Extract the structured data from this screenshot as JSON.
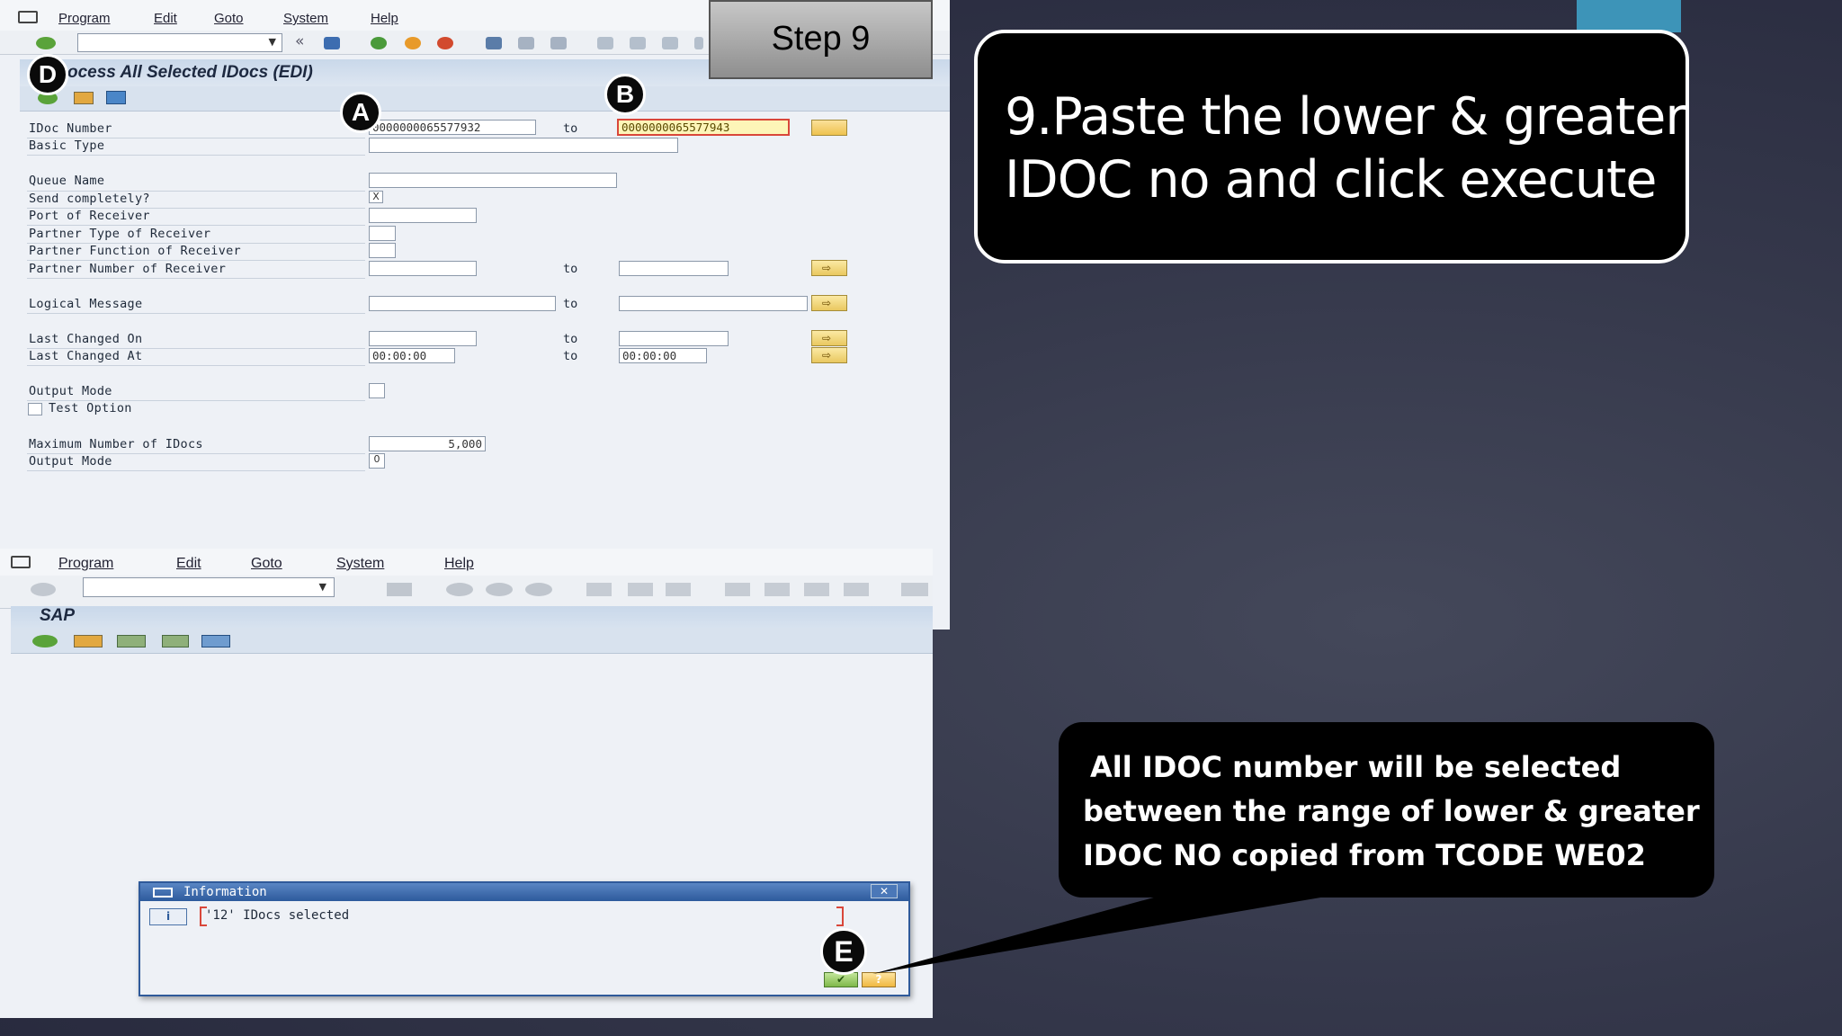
{
  "step": {
    "label": "Step 9"
  },
  "callouts": {
    "main_line1": "9.Paste the lower & greater",
    "main_line2": "IDOC no and click execute",
    "note_line1": "All IDOC number will be selected",
    "note_line2": "between the range of lower & greater",
    "note_line3": "IDOC NO copied from TCODE WE02"
  },
  "badges": {
    "a": "A",
    "b": "B",
    "d": "D",
    "e": "E"
  },
  "sap_top": {
    "menu": [
      "Program",
      "Edit",
      "Goto",
      "System",
      "Help"
    ],
    "title": "ocess All Selected IDocs (EDI)",
    "labels": {
      "idoc_number": "IDoc Number",
      "basic_type": "Basic Type",
      "queue_name": "Queue Name",
      "send_completely": "Send completely?",
      "port_of_receiver": "Port of Receiver",
      "partner_type": "Partner Type of Receiver",
      "partner_function": "Partner Function of Receiver",
      "partner_number": "Partner Number of Receiver",
      "logical_message": "Logical Message",
      "last_changed_on": "Last Changed On",
      "last_changed_at": "Last Changed At",
      "output_mode": "Output Mode",
      "test_option": "Test Option",
      "max_idocs": "Maximum Number of IDocs",
      "output_mode2": "Output Mode",
      "to": "to"
    },
    "values": {
      "idoc_from": "0000000065577932",
      "idoc_to": "0000000065577943",
      "send_completely": "X",
      "time_from": "00:00:00",
      "time_to": "00:00:00",
      "max_idocs": "5,000",
      "output_mode2": "0"
    }
  },
  "sap_bottom": {
    "menu": [
      "Program",
      "Edit",
      "Goto",
      "System",
      "Help"
    ],
    "title": "SAP"
  },
  "dialog": {
    "title": "Information",
    "message": "'12' IDocs selected"
  }
}
